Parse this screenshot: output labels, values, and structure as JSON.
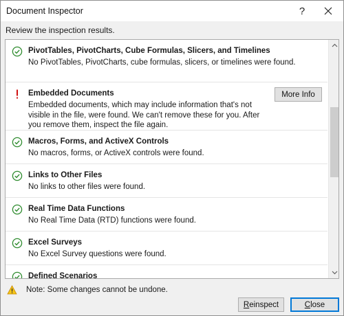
{
  "dialog": {
    "title": "Document Inspector",
    "help_glyph": "?",
    "subtitle": "Review the inspection results."
  },
  "items": [
    {
      "status": "ok",
      "icon": "check-circle-icon",
      "title": "PivotTables, PivotCharts, Cube Formulas, Slicers, and Timelines",
      "desc": "No PivotTables, PivotCharts, cube formulas, slicers, or timelines were found."
    },
    {
      "status": "warning",
      "icon": "exclamation-icon",
      "title": "Embedded Documents",
      "desc": "Embedded documents, which may include information that's not visible in the file, were found. We can't remove these for you. After you remove them, inspect the file again.",
      "action_label": "More Info"
    },
    {
      "status": "ok",
      "icon": "check-circle-icon",
      "title": "Macros, Forms, and ActiveX Controls",
      "desc": "No macros, forms, or ActiveX controls were found."
    },
    {
      "status": "ok",
      "icon": "check-circle-icon",
      "title": "Links to Other Files",
      "desc": "No links to other files were found."
    },
    {
      "status": "ok",
      "icon": "check-circle-icon",
      "title": "Real Time Data Functions",
      "desc": "No Real Time Data (RTD) functions were found."
    },
    {
      "status": "ok",
      "icon": "check-circle-icon",
      "title": "Excel Surveys",
      "desc": "No Excel Survey questions were found."
    },
    {
      "status": "ok",
      "icon": "check-circle-icon",
      "title": "Defined Scenarios",
      "desc": ""
    }
  ],
  "footer": {
    "note": "Note: Some changes cannot be undone.",
    "reinspect_mnemonic": "R",
    "reinspect_rest": "einspect",
    "close_mnemonic": "C",
    "close_rest": "lose"
  },
  "colors": {
    "ok": "#2e8b2e",
    "warning": "#d01010",
    "note_warning": "#e8a317",
    "default_button_border": "#0078d7"
  }
}
